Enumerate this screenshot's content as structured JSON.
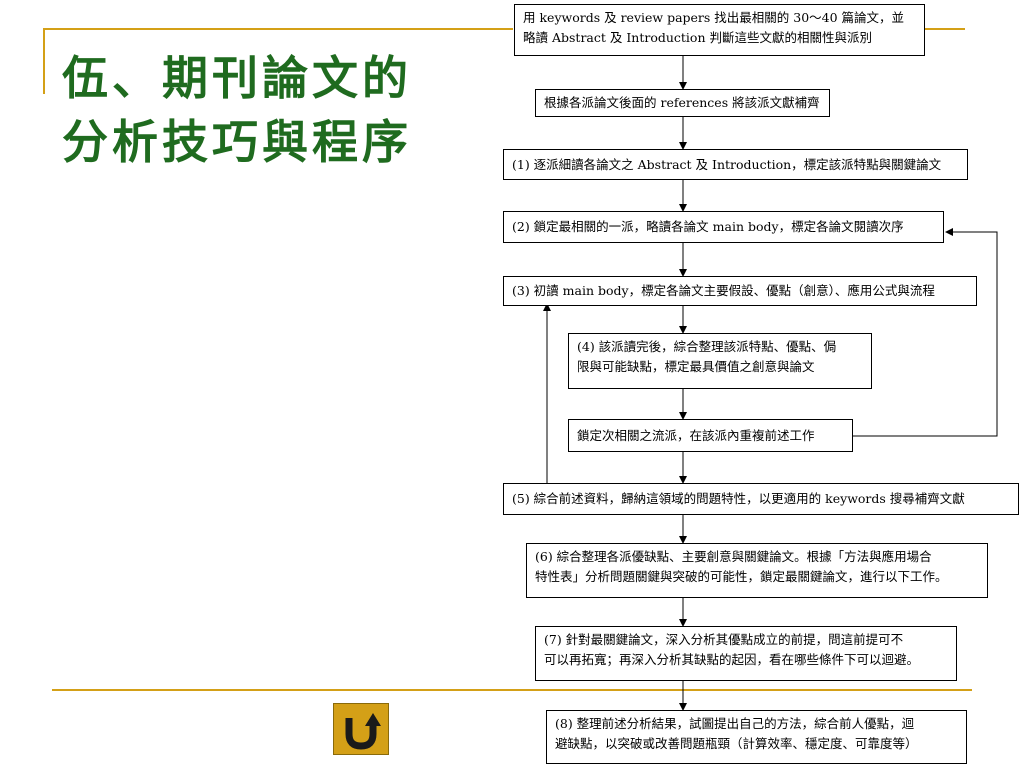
{
  "title": {
    "line1": "伍、期刊論文的",
    "line2": "分析技巧與程序"
  },
  "flowchart": {
    "steps": [
      {
        "id": "s0",
        "lines": [
          "用 keywords 及 review papers 找出最相關的 30～40 篇論文，並",
          "略讀 Abstract 及 Introduction 判斷這些文獻的相關性與派別"
        ]
      },
      {
        "id": "s1",
        "lines": [
          "根據各派論文後面的 references 將該派文獻補齊"
        ]
      },
      {
        "id": "s2",
        "lines": [
          "(1) 逐派細讀各論文之 Abstract 及 Introduction，標定該派特點與關鍵論文"
        ]
      },
      {
        "id": "s3",
        "lines": [
          "(2) 鎖定最相關的一派，略讀各論文 main body，標定各論文閱讀次序"
        ]
      },
      {
        "id": "s4",
        "lines": [
          "(3) 初讀 main body，標定各論文主要假設、優點（創意）、應用公式與流程"
        ]
      },
      {
        "id": "s5",
        "lines": [
          "(4) 該派讀完後，綜合整理該派特點、優點、侷",
          "限與可能缺點，標定最具價值之創意與論文"
        ]
      },
      {
        "id": "s6",
        "lines": [
          "鎖定次相關之流派，在該派內重複前述工作"
        ]
      },
      {
        "id": "s7",
        "lines": [
          "(5) 綜合前述資料，歸納這領域的問題特性，以更適用的 keywords 搜尋補齊文獻"
        ]
      },
      {
        "id": "s8",
        "lines": [
          "(6) 綜合整理各派優缺點、主要創意與關鍵論文。根據「方法與應用場合",
          "特性表」分析問題關鍵與突破的可能性，鎖定最關鍵論文，進行以下工作。"
        ]
      },
      {
        "id": "s9",
        "lines": [
          "(7) 針對最關鍵論文，深入分析其優點成立的前提，問這前提可不",
          "可以再拓寬；再深入分析其缺點的起因，看在哪些條件下可以迴避。"
        ]
      },
      {
        "id": "s10",
        "lines": [
          "(8) 整理前述分析結果，試圖提出自己的方法，綜合前人優點，迴",
          "避缺點，以突破或改善問題瓶頸（計算效率、穩定度、可靠度等）"
        ]
      }
    ]
  },
  "nav": {
    "home_icon": "return-arrow-icon"
  },
  "colors": {
    "accent": "#d4a017",
    "title": "#1f6b1f",
    "icon": "#1a1a1a"
  }
}
